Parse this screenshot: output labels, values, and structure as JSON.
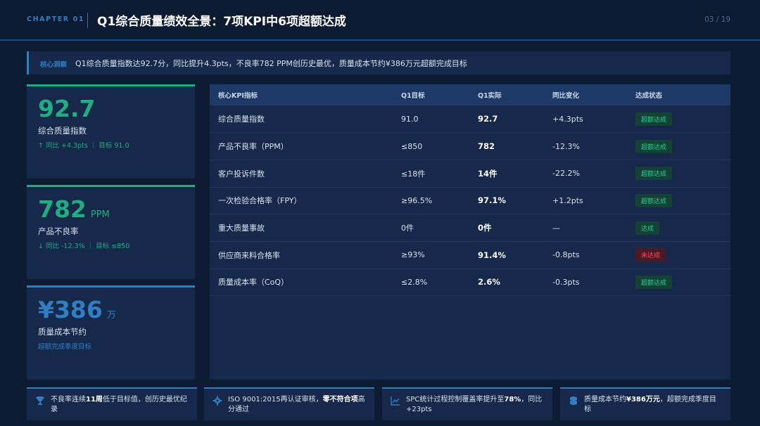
{
  "header": {
    "chapter": "CHAPTER 01",
    "title": "Q1综合质量绩效全景：7项KPI中6项超额达成",
    "page": "03 / 19"
  },
  "insight": {
    "tag": "核心洞察",
    "text": "Q1综合质量指数达92.7分，同比提升4.3pts，不良率782 PPM创历史最优，质量成本节约¥386万元超额完成目标"
  },
  "kpis": [
    {
      "value": "92.7",
      "unit": "",
      "label": "综合质量指数",
      "sub": "↑ 同比 +4.3pts ｜ 目标 91.0"
    },
    {
      "value": "782",
      "unit": "PPM",
      "label": "产品不良率",
      "sub": "↓ 同比 -12.3% ｜ 目标 ≤850"
    },
    {
      "value": "¥386",
      "unit": "万",
      "label": "质量成本节约",
      "sub": "超额完成季度目标"
    }
  ],
  "table": {
    "headers": [
      "核心KPI指标",
      "Q1目标",
      "Q1实际",
      "同比变化",
      "达成状态"
    ],
    "rows": [
      {
        "name": "综合质量指数",
        "target": "91.0",
        "actual": "92.7",
        "change": "+4.3pts",
        "status": "超额达成"
      },
      {
        "name": "产品不良率（PPM）",
        "target": "≤850",
        "actual": "782",
        "change": "-12.3%",
        "status": "超额达成"
      },
      {
        "name": "客户投诉件数",
        "target": "≤18件",
        "actual": "14件",
        "change": "-22.2%",
        "status": "超额达成"
      },
      {
        "name": "一次检验合格率（FPY）",
        "target": "≥96.5%",
        "actual": "97.1%",
        "change": "+1.2pts",
        "status": "超额达成"
      },
      {
        "name": "重大质量事故",
        "target": "0件",
        "actual": "0件",
        "change": "—",
        "status": "达成"
      },
      {
        "name": "供应商来料合格率",
        "target": "≥93%",
        "actual": "91.4%",
        "change": "-0.8pts",
        "status": "未达成"
      },
      {
        "name": "质量成本率（CoQ）",
        "target": "≤2.8%",
        "actual": "2.6%",
        "change": "-0.3pts",
        "status": "超额达成"
      }
    ]
  },
  "footer": [
    {
      "icon": "trophy-icon",
      "pre": "不良率连续",
      "bold": "11周",
      "post": "低于目标值，创历史最优纪录"
    },
    {
      "icon": "gear-icon",
      "pre": "ISO 9001:2015再认证审核，",
      "bold": "零不符合项",
      "post": "高分通过"
    },
    {
      "icon": "chart-line-icon",
      "pre": "SPC统计过程控制覆盖率提升至",
      "bold": "78%",
      "post": "，同比+23pts"
    },
    {
      "icon": "coins-icon",
      "pre": "质量成本节约",
      "bold": "¥386万元",
      "post": "，超额完成季度目标"
    }
  ],
  "colors": {
    "accent_green": "#1fae82",
    "accent_blue": "#2f7fc4",
    "fail_red": "#ff4d5e",
    "background": "#0d1b33"
  }
}
